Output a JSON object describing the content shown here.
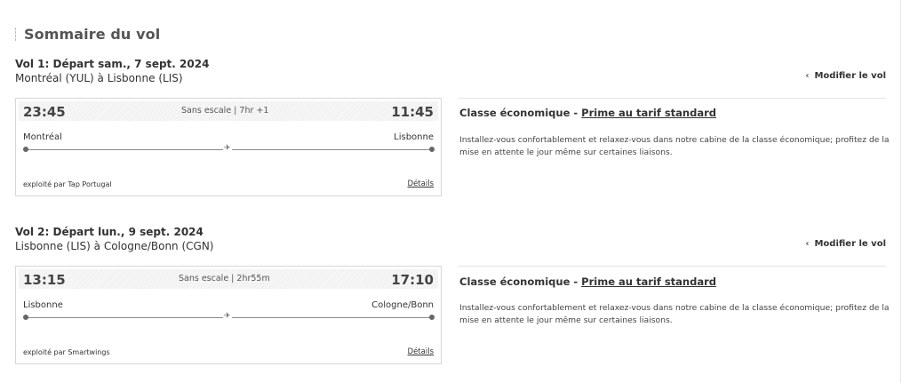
{
  "page": {
    "title": "Sommaire du vol"
  },
  "flights": [
    {
      "header": "Vol 1: Départ sam., 7 sept. 2024",
      "route": "Montréal (YUL) à Lisbonne (LIS)",
      "modify_label": "Modifier le vol",
      "departure_time": "23:45",
      "arrival_time": "11:45",
      "stop_info": "Sans escale | 7hr +1",
      "origin_city": "Montréal",
      "destination_city": "Lisbonne",
      "operated_by": "exploité par Tap Portugal",
      "details_label": "Détails",
      "cabin_prefix": "Classe économique - ",
      "fare_label": "Prime au tarif standard",
      "cabin_description": "Installez-vous confortablement et relaxez-vous dans notre cabine de la classe économique; profitez de la mise en attente le jour même sur certaines liaisons."
    },
    {
      "header": "Vol 2: Départ lun., 9 sept. 2024",
      "route": "Lisbonne (LIS) à Cologne/Bonn (CGN)",
      "modify_label": "Modifier le vol",
      "departure_time": "13:15",
      "arrival_time": "17:10",
      "stop_info": "Sans escale | 2hr55m",
      "origin_city": "Lisbonne",
      "destination_city": "Cologne/Bonn",
      "operated_by": "exploité par Smartwings",
      "details_label": "Détails",
      "cabin_prefix": "Classe économique - ",
      "fare_label": "Prime au tarif standard",
      "cabin_description": "Installez-vous confortablement et relaxez-vous dans notre cabine de la classe économique; profitez de la mise en attente le jour même sur certaines liaisons."
    }
  ],
  "icons": {
    "modify": "chevron-left-icon",
    "plane": "airplane-icon"
  }
}
